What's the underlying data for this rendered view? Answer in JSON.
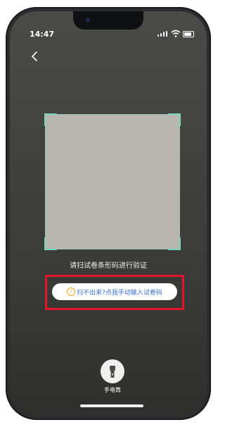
{
  "status_bar": {
    "time": "14:47"
  },
  "scanner": {
    "hint": "请扫试卷条形码进行验证",
    "manual_entry_label": "扫不出来?点我手动输入试卷码",
    "manual_entry_icon_glyph": "?"
  },
  "flashlight": {
    "label": "手电筒"
  },
  "colors": {
    "frame_accent": "#79d6c6",
    "highlight": "#e1162d",
    "link": "#3c6fd6",
    "warning": "#f0a21b"
  },
  "icons": [
    "back-icon",
    "signal-icon",
    "wifi-icon",
    "battery-icon",
    "question-icon",
    "flashlight-icon"
  ]
}
